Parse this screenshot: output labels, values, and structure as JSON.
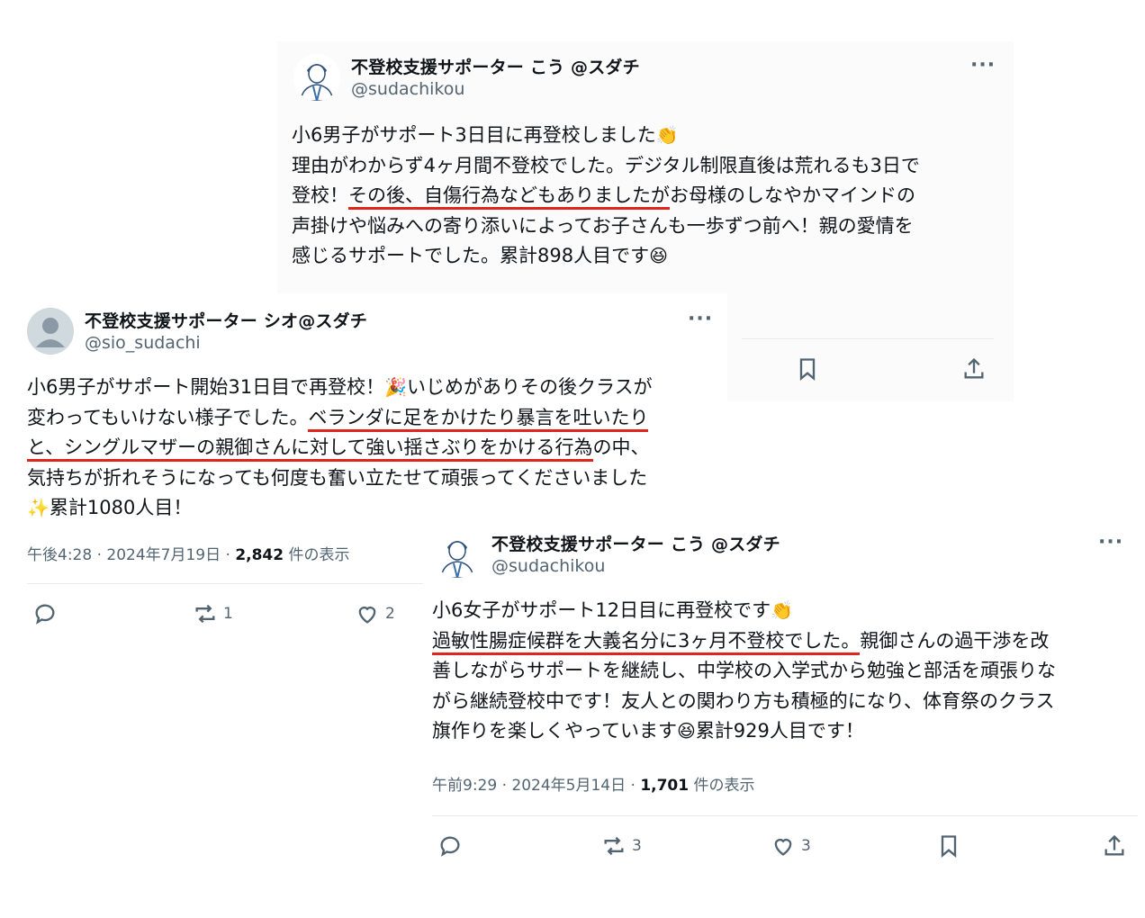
{
  "tweet1": {
    "display_name": "不登校支援サポーター こう @スダチ",
    "handle": "@sudachikou",
    "more": "···",
    "lines": [
      [
        "小6男子がサポート3日目に再登校しました",
        "👏"
      ],
      [
        "理由がわからず4ヶ月間不登校でした。デジタル制限直後は荒れるも3日で"
      ],
      [
        "登校！",
        "その後、自傷行為などもありましたが",
        "お母様のしなやかマインドの"
      ],
      [
        "声掛けや悩みへの寄り添いによってお子さんも一歩ずつ前へ！親の愛情を"
      ],
      [
        "感じるサポートでした。累計898人目です",
        "😆"
      ]
    ]
  },
  "tweet2": {
    "display_name": "不登校支援サポーター シオ@スダチ",
    "handle": "@sio_sudachi",
    "more": "···",
    "lines": [
      [
        "小6男子がサポート開始31日目で再登校！",
        "🎉",
        "いじめがありその後クラスが"
      ],
      [
        "変わってもいけない様子でした。",
        "ベランダに足をかけたり暴言を吐いたり"
      ],
      [
        "と、シングルマザーの親御さんに対して強い揺さぶりをかける行為",
        "の中、"
      ],
      [
        "気持ちが折れそうになっても何度も奮い立たせて頑張ってくださいました"
      ],
      [
        "✨",
        "累計1080人目！"
      ]
    ],
    "time": "午後4:28 · 2024年7月19日 · ",
    "views": "2,842",
    "views_suffix": " 件の表示",
    "retweets": "1",
    "likes": "2"
  },
  "tweet3": {
    "display_name": "不登校支援サポーター こう @スダチ",
    "handle": "@sudachikou",
    "more": "···",
    "lines": [
      [
        "小6女子がサポート12日目に再登校です",
        "👏"
      ],
      [
        "過敏性腸症候群を大義名分に3ヶ月不登校でした。",
        "親御さんの過干渉を改"
      ],
      [
        "善しながらサポートを継続し、中学校の入学式から勉強と部活を頑張りな"
      ],
      [
        "がら継続登校中です！友人との関わり方も積極的になり、体育祭のクラス"
      ],
      [
        "旗作りを楽しくやっています",
        "😆",
        "累計929人目です！"
      ]
    ],
    "time": "午前9:29 · 2024年5月14日 · ",
    "views": "1,701",
    "views_suffix": " 件の表示",
    "retweets": "3",
    "likes": "3"
  },
  "colors": {
    "underline": "#e0261c",
    "muted": "#536471",
    "text": "#0f1419"
  },
  "icons": [
    "reply-icon",
    "retweet-icon",
    "like-icon",
    "bookmark-icon",
    "share-icon",
    "more-icon"
  ]
}
